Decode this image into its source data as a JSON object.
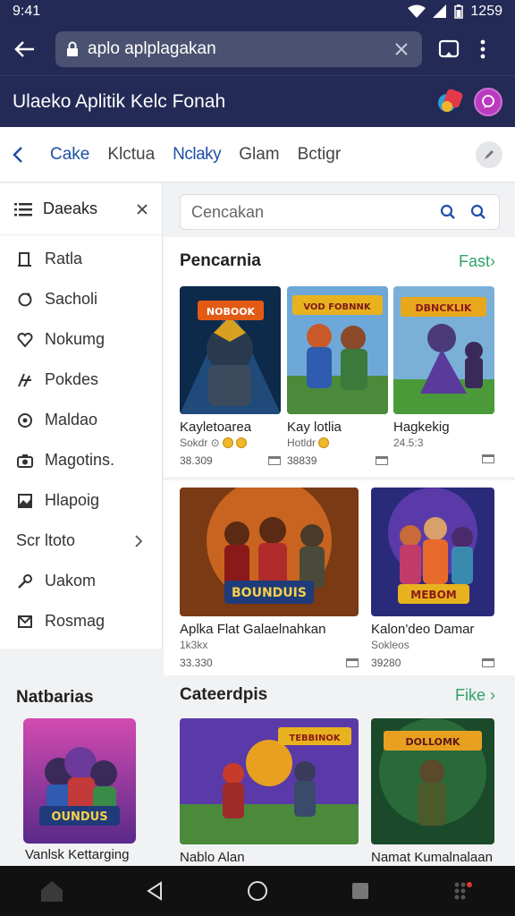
{
  "status": {
    "time": "9:41",
    "battery": "1259"
  },
  "browser": {
    "url": "aplo aplplagakan"
  },
  "app": {
    "title": "Ulaeko Aplitik Kelc Fonah"
  },
  "nav": {
    "items": [
      "Cake",
      "Klctua",
      "Nclaky",
      "Glam",
      "Bctigr"
    ]
  },
  "sidebar": {
    "header": "Daeaks",
    "items": [
      {
        "label": "Ratla",
        "icon": "door-icon"
      },
      {
        "label": "Sacholi",
        "icon": "refresh-icon"
      },
      {
        "label": "Nokumg",
        "icon": "heart-icon"
      },
      {
        "label": "Pokdes",
        "icon": "puzzle-icon"
      },
      {
        "label": "Maldao",
        "icon": "disc-icon"
      },
      {
        "label": "Magotins.",
        "icon": "camera-icon"
      },
      {
        "label": "Hlapoig",
        "icon": "image-icon"
      },
      {
        "label": "Scr ltoto",
        "icon": "chevron-right-icon"
      },
      {
        "label": "Uakom",
        "icon": "wrench-icon"
      },
      {
        "label": "Rosmag",
        "icon": "mail-icon"
      }
    ],
    "section_title": "Natbarias",
    "feature_title": "Vanlsk Kettarging"
  },
  "search": {
    "placeholder": "Cencakan"
  },
  "sections": [
    {
      "title": "Pencarnia",
      "link": "Fast›",
      "cards": [
        {
          "name": "Kayletoarea",
          "meta": "Sokdr ⊙",
          "count": "38.309"
        },
        {
          "name": "Kay lotlia",
          "meta": "Hotldr",
          "count": "38839"
        },
        {
          "name": "Hagkekig",
          "meta": "24.5:3",
          "count": ""
        }
      ]
    },
    {
      "title": "",
      "link": "",
      "cards": [
        {
          "name": "Aplka Flat Galaelnahkan",
          "meta": "1k3kx",
          "count": "33.330"
        },
        {
          "name": "Kalon'deo Damar",
          "meta": "Sokleos",
          "count": "39280"
        }
      ]
    },
    {
      "title": "Cateerdpis",
      "link": "Fike ›",
      "cards": [
        {
          "name": "Nablo Alan"
        },
        {
          "name": "Namat Kumalnalaan"
        }
      ]
    }
  ],
  "art_titles": {
    "a1": "NOBOOK",
    "a2": "VOD FOBNNK",
    "a3": "DBNCKLIK",
    "b1": "BOUNDUIS",
    "b2": "MEBOM",
    "c1": "TEBBINOK",
    "c2": "DOLLOMK",
    "side": "OUNDUS"
  },
  "colors": {
    "topbar": "#232a55",
    "accent_green": "#2fa36a",
    "link_blue": "#1f4fa8"
  }
}
